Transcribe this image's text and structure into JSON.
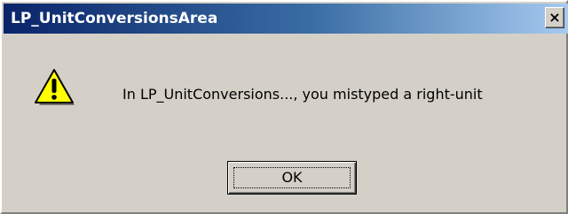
{
  "dialog": {
    "title": "LP_UnitConversionsArea",
    "close_label": "×",
    "icon": "warning-icon",
    "message": "In LP_UnitConversions..., you mistyped a right-unit",
    "ok_label": "OK"
  },
  "colors": {
    "title_bar_start": "#0a246a",
    "title_bar_end": "#a6caf0",
    "dialog_background": "#d4d0c8",
    "warning_fill": "#ffff00"
  }
}
